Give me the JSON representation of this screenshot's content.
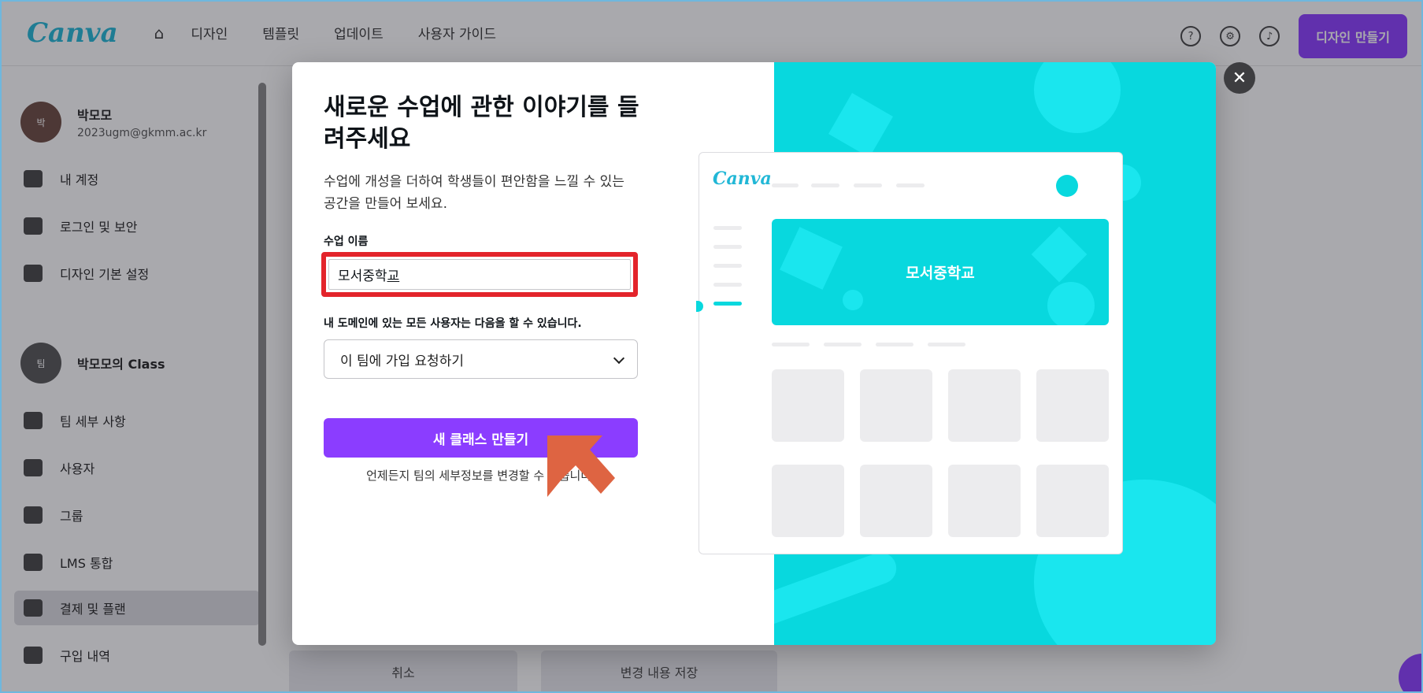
{
  "background": {
    "logo": "Canva",
    "nav": {
      "home_icon": "home-icon",
      "items": [
        "디자인",
        "템플릿",
        "업데이트",
        "사용자 가이드"
      ]
    },
    "top_right": {
      "icons": [
        "help-icon",
        "settings-icon",
        "bell-icon"
      ],
      "create_label": "디자인 만들기"
    },
    "sidebar": {
      "profile1": {
        "initials": "박",
        "name": "박모모",
        "email": "2023ugm@gkmm.ac.kr"
      },
      "items1": [
        "내 계정",
        "로그인 및 보안",
        "디자인 기본 설정"
      ],
      "profile2": {
        "initials": "팀",
        "name": "박모모의 Class"
      },
      "items2": [
        "팀 세부 사항",
        "사용자",
        "그룹",
        "LMS 통합",
        "결제 및 플랜",
        "구입 내역"
      ]
    },
    "bottom_tabs": [
      "취소",
      "변경 내용 저장"
    ]
  },
  "modal": {
    "title": "새로운 수업에 관한 이야기를 들려주세요",
    "description": "수업에 개성을 더하여 학생들이 편안함을 느낄 수 있는 공간을 만들어 보세요.",
    "name_label": "수업 이름",
    "name_value_main": "모서중학",
    "name_value_composing": "교",
    "permission_label": "내 도메인에 있는 모든 사용자는 다음을 할 수 있습니다.",
    "permission_value": "이 팀에 가입 요청하기",
    "create_button": "새 클래스 만들기",
    "hint": "언제든지 팀의 세부정보를 변경할 수 있습니다.",
    "close_icon": "close-icon",
    "cursor_icon": "arrow-cursor-icon"
  },
  "preview": {
    "logo": "Canva",
    "banner_title": "모서중학교",
    "accent_color": "#08d8de"
  },
  "colors": {
    "brand_purple": "#8b3dff",
    "highlight_red": "#e3242b",
    "teal": "#08d8de",
    "cursor_orange": "#de6442"
  }
}
